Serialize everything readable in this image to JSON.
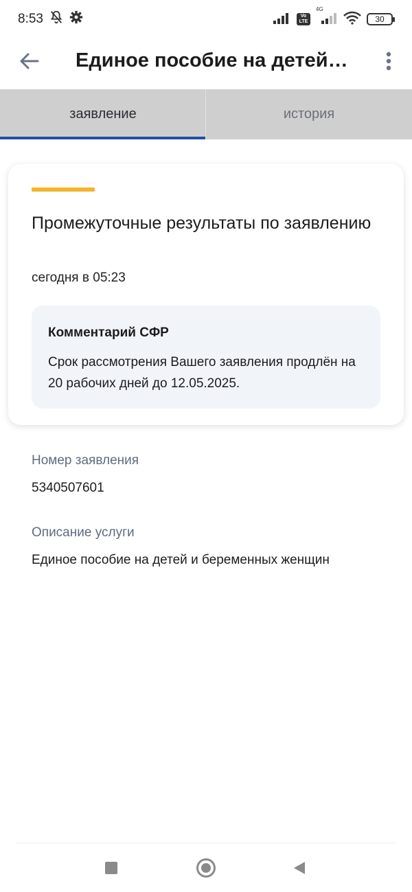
{
  "status_bar": {
    "time": "8:53",
    "battery": "30",
    "network": "4G"
  },
  "header": {
    "title": "Единое пособие на детей…"
  },
  "tabs": [
    {
      "label": "заявление",
      "active": true
    },
    {
      "label": "история",
      "active": false
    }
  ],
  "card": {
    "title": "Промежуточные результаты по заявлению",
    "time": "сегодня в 05:23",
    "comment": {
      "title": "Комментарий СФР",
      "text": "Срок рассмотрения Вашего заявления продлён на 20 рабочих дней до 12.05.2025."
    }
  },
  "fields": [
    {
      "label": "Номер заявления",
      "value": "5340507601"
    },
    {
      "label": "Описание услуги",
      "value": "Единое пособие на детей и беременных женщин"
    }
  ],
  "colors": {
    "accent": "#f2b52c",
    "tab_indicator": "#1f4fa8",
    "tab_background": "#cfcfcf",
    "comment_background": "#f1f4f9",
    "label_text": "#5f6b7f"
  },
  "icons": {
    "back": "arrow-left-icon",
    "more": "more-vertical-icon",
    "silent": "bell-off-icon",
    "settings": "gear-icon",
    "wifi": "wifi-icon",
    "signal": "signal-icon"
  }
}
